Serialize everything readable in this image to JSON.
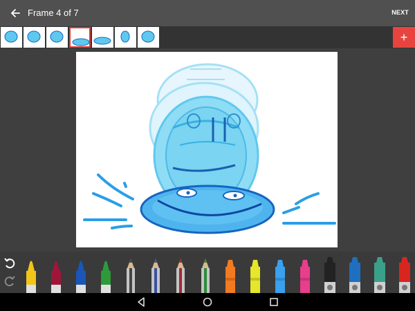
{
  "header": {
    "title": "Frame 4 of 7",
    "next_label": "NEXT",
    "add_label": "+"
  },
  "frames": {
    "count": 7,
    "selected_index": 3
  },
  "colors": {
    "topbar": "#505050",
    "accent": "#e8443f",
    "ink_light": "#5fc8ee",
    "ink_dark": "#1565c0"
  },
  "palette": {
    "markers": [
      {
        "kind": "marker",
        "color": "#f2c518"
      },
      {
        "kind": "marker",
        "color": "#a0163a"
      },
      {
        "kind": "marker",
        "color": "#1a56b8"
      },
      {
        "kind": "marker",
        "color": "#2e9a3a"
      },
      {
        "kind": "pencil",
        "color": "#444444"
      },
      {
        "kind": "pencil",
        "color": "#3a50a0"
      },
      {
        "kind": "pencil",
        "color": "#a0283a"
      },
      {
        "kind": "pencil",
        "color": "#2e8a3a"
      },
      {
        "kind": "highlighter",
        "color": "#f47a1f"
      },
      {
        "kind": "highlighter",
        "color": "#e6e62a"
      },
      {
        "kind": "highlighter",
        "color": "#3aa0ef"
      },
      {
        "kind": "highlighter",
        "color": "#e83e8c"
      },
      {
        "kind": "sharpie",
        "color": "#222222"
      },
      {
        "kind": "sharpie",
        "color": "#1e6fbf"
      },
      {
        "kind": "sharpie",
        "color": "#3aa08a"
      },
      {
        "kind": "sharpie",
        "color": "#d8261e"
      }
    ]
  }
}
